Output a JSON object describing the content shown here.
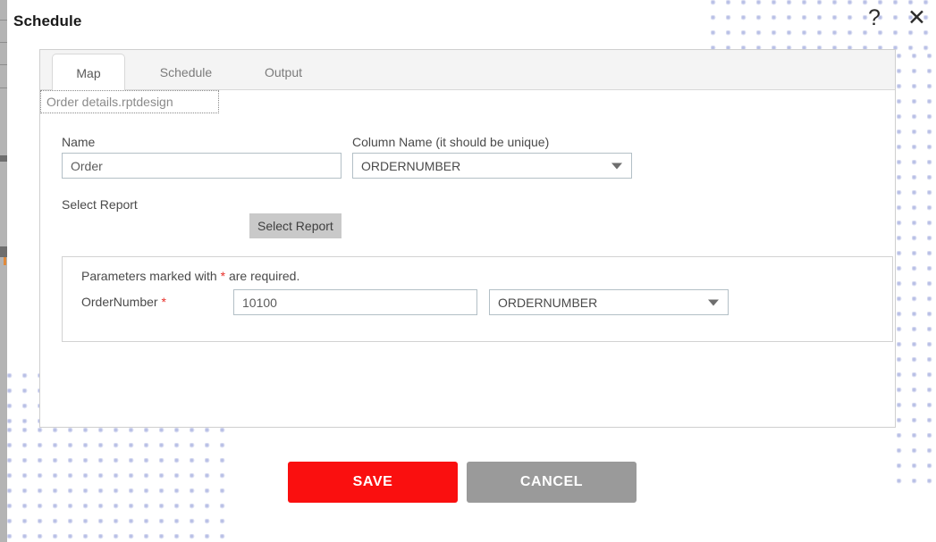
{
  "dialog": {
    "title": "Schedule",
    "help_icon": "?",
    "close_icon": "✕"
  },
  "tabs": [
    {
      "id": "map",
      "label": "Map",
      "active": true
    },
    {
      "id": "schedule",
      "label": "Schedule",
      "active": false
    },
    {
      "id": "output",
      "label": "Output",
      "active": false
    }
  ],
  "form": {
    "name": {
      "label": "Name",
      "value": "Order"
    },
    "column_name": {
      "label": "Column Name (it should be unique)",
      "value": "ORDERNUMBER",
      "caret_icon": "chevron-down-icon"
    },
    "select_report": {
      "label": "Select Report",
      "file_name": "Order details.rptdesign",
      "button_label": "Select Report"
    }
  },
  "parameters": {
    "note_prefix": "Parameters marked with ",
    "note_star": "*",
    "note_suffix": " are required.",
    "rows": [
      {
        "label": "OrderNumber",
        "required_star": "*",
        "value": "10100",
        "column": "ORDERNUMBER",
        "caret_icon": "chevron-down-icon"
      }
    ]
  },
  "footer": {
    "save_label": "SAVE",
    "cancel_label": "CANCEL"
  },
  "colors": {
    "save_red": "#fa0f0f",
    "cancel_gray": "#9a9a9a",
    "required_red": "#e8302a",
    "dot_pattern": "#b9c0e6",
    "tabstrip_bg": "#f4f4f4"
  }
}
